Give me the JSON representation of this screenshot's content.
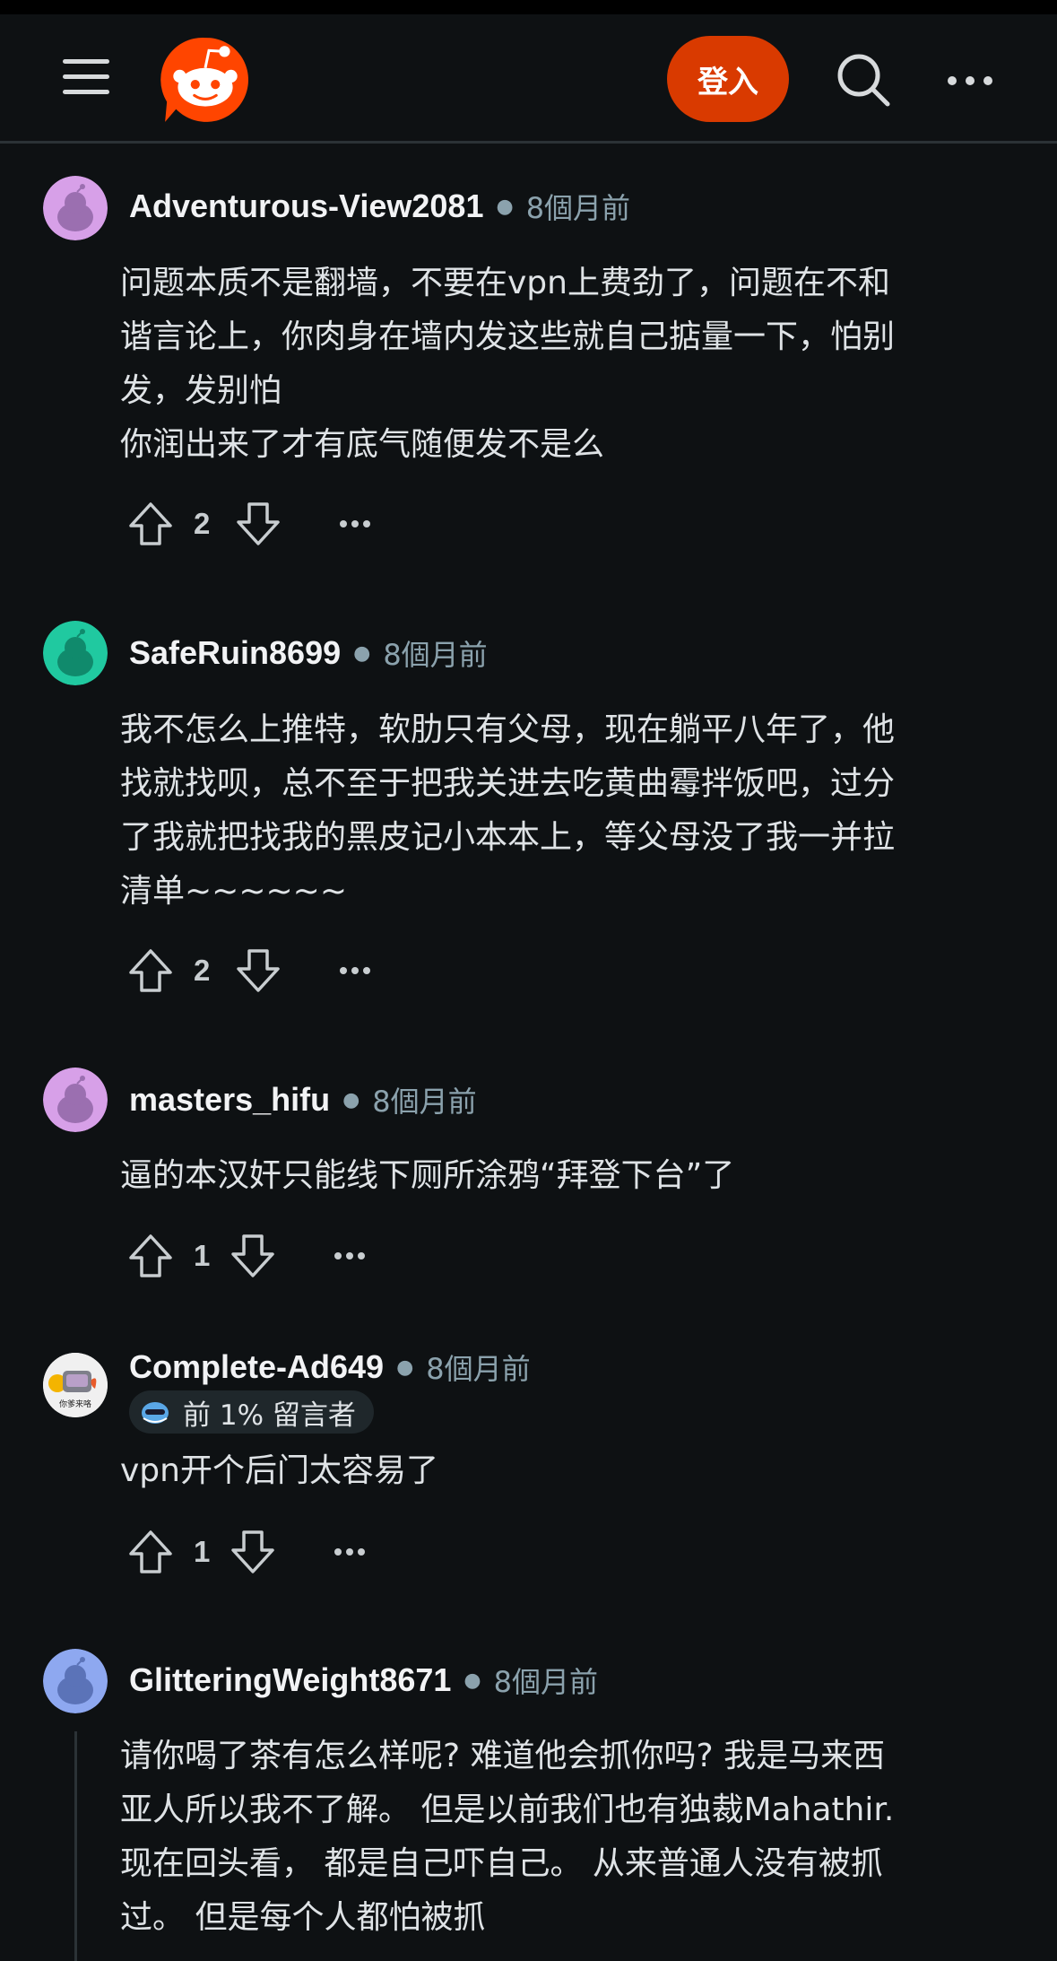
{
  "header": {
    "menu_icon": "hamburger-menu-icon",
    "logo_icon": "reddit-snoo-logo",
    "login_label": "登入",
    "search_icon": "search-icon",
    "more_icon": "more-horizontal-icon",
    "brand_color": "#d93a00"
  },
  "comments": [
    {
      "username": "Adventurous-View2081",
      "time": "8個月前",
      "avatar_color": "#d7a0e8",
      "body_lines": [
        "问题本质不是翻墙，不要在vpn上费劲了，问题在不和",
        "谐言论上，你肉身在墙内发这些就自己掂量一下，怕别",
        "发，发别怕",
        "你润出来了才有底气随便发不是么"
      ],
      "votes": "2"
    },
    {
      "username": "SafeRuin8699",
      "time": "8個月前",
      "avatar_color": "#20c9a0",
      "body_lines": [
        "我不怎么上推特，软肋只有父母，现在躺平八年了，他",
        "找就找呗，总不至于把我关进去吃黄曲霉拌饭吧，过分",
        "了我就把找我的黑皮记小本本上，等父母没了我一并拉",
        "清单~~~~~~"
      ],
      "votes": "2"
    },
    {
      "username": "masters_hifu",
      "time": "8個月前",
      "avatar_color": "#d7a0e8",
      "body_lines": [
        "逼的本汉奸只能线下厕所涂鸦“拜登下台”了"
      ],
      "votes": "1"
    },
    {
      "username": "Complete-Ad649",
      "time": "8個月前",
      "avatar_caption": "你爹来咯",
      "flair": "前 1% 留言者",
      "body_lines": [
        "vpn开个后门太容易了"
      ],
      "votes": "1"
    },
    {
      "username": "GlitteringWeight8671",
      "time": "8個月前",
      "avatar_color": "#8ea8f0",
      "body_lines": [
        "请你喝了茶有怎么样呢? 难道他会抓你吗? 我是马来西",
        "亚人所以我不了解。 但是以前我们也有独裁Mahathir.",
        "现在回头看， 都是自己吓自己。 从来普通人没有被抓",
        "过。 但是每个人都怕被抓"
      ]
    }
  ],
  "icons": {
    "upvote": "upvote-arrow-icon",
    "downvote": "downvote-arrow-icon",
    "overflow": "overflow-ellipsis-icon",
    "flair_badge": "top-commenter-badge-icon"
  }
}
